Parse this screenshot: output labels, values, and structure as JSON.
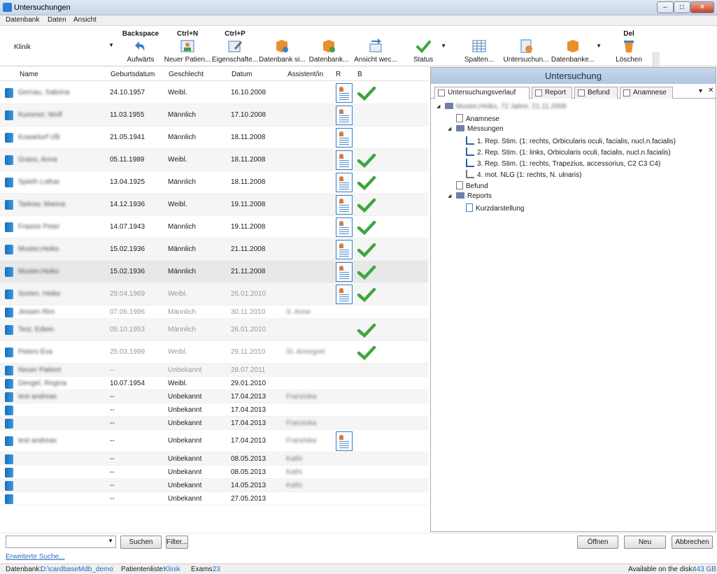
{
  "window": {
    "title": "Untersuchungen",
    "min": "‒",
    "max": "□",
    "close": "✕"
  },
  "menu": [
    "Datenbank",
    "Daten",
    "Ansicht"
  ],
  "toolbar": {
    "scope_value": "Klinik",
    "buttons": [
      {
        "shortcut": "Backspace",
        "label": "Aufwärts"
      },
      {
        "shortcut": "Ctrl+N",
        "label": "Neuer Patien..."
      },
      {
        "shortcut": "Ctrl+P",
        "label": "Eigenschafte..."
      },
      {
        "shortcut": "",
        "label": "Datenbank si..."
      },
      {
        "shortcut": "",
        "label": "Datenbank..."
      },
      {
        "shortcut": "",
        "label": "Ansicht wec..."
      },
      {
        "shortcut": "",
        "label": "Status"
      },
      {
        "shortcut": "",
        "label": "Spalten..."
      },
      {
        "shortcut": "",
        "label": "Untersuchun..."
      },
      {
        "shortcut": "",
        "label": "Datenbanke..."
      },
      {
        "shortcut": "Del",
        "label": "Löschen"
      }
    ]
  },
  "table": {
    "headers": [
      "Name",
      "Geburtsdatum",
      "Geschlecht",
      "Datum",
      "Assistent/in",
      "R",
      "B"
    ],
    "rows": [
      {
        "name": "Gernau, Sabrina",
        "birth": "24.10.1957",
        "sex": "Weibl.",
        "date": "16.10.2008",
        "asst": "",
        "r": true,
        "b": true
      },
      {
        "name": "Kummer, Wolf",
        "birth": "11.03.1955",
        "sex": "Männlich",
        "date": "17.10.2008",
        "asst": "",
        "r": true,
        "b": false
      },
      {
        "name": "Kowarturf Ulli",
        "birth": "21.05.1941",
        "sex": "Männlich",
        "date": "18.11.2008",
        "asst": "",
        "r": true,
        "b": false
      },
      {
        "name": "Graos, Anna",
        "birth": "05.11.1989",
        "sex": "Weibl.",
        "date": "18.11.2008",
        "asst": "",
        "r": true,
        "b": true
      },
      {
        "name": "Spieth Lothar",
        "birth": "13.04.1925",
        "sex": "Männlich",
        "date": "18.11.2008",
        "asst": "",
        "r": true,
        "b": true
      },
      {
        "name": "Tarkow, Marina",
        "birth": "14.12.1936",
        "sex": "Weibl.",
        "date": "19.11.2008",
        "asst": "",
        "r": true,
        "b": true
      },
      {
        "name": "Frasnix Peter",
        "birth": "14.07.1943",
        "sex": "Männlich",
        "date": "19.11.2008",
        "asst": "",
        "r": true,
        "b": true
      },
      {
        "name": "Muster,Heiko",
        "birth": "15.02.1936",
        "sex": "Männlich",
        "date": "21.11.2008",
        "asst": "",
        "r": true,
        "b": true
      },
      {
        "name": "Muster,Heiko",
        "birth": "15.02.1936",
        "sex": "Männlich",
        "date": "21.11.2008",
        "asst": "",
        "r": true,
        "b": true
      },
      {
        "name": "Sorten, Heike",
        "birth": "29.04.1969",
        "sex": "Weibl.",
        "date": "26.01.2010",
        "asst": "",
        "r": true,
        "b": true
      },
      {
        "name": "Jessen Rim",
        "birth": "07.06.1996",
        "sex": "Männlich",
        "date": "30.11.2010",
        "asst": "S. Anne",
        "r": false,
        "b": false
      },
      {
        "name": "Test, Edwin",
        "birth": "05.10.1953",
        "sex": "Männlich",
        "date": "26.01.2010",
        "asst": "",
        "r": false,
        "b": true
      },
      {
        "name": "Peters Eva",
        "birth": "25.03.1999",
        "sex": "Weibl.",
        "date": "29.11.2010",
        "asst": "St. Annegret",
        "r": false,
        "b": true
      },
      {
        "name": "Neuer Patient",
        "birth": "--",
        "sex": "Unbekannt",
        "date": "28.07.2011",
        "asst": "",
        "r": false,
        "b": false
      },
      {
        "name": "Dengel, Regina",
        "birth": "10.07.1954",
        "sex": "Weibl.",
        "date": "29.01.2010",
        "asst": "",
        "r": false,
        "b": false
      },
      {
        "name": "test andreas",
        "birth": "--",
        "sex": "Unbekannt",
        "date": "17.04.2013",
        "asst": "Franziska",
        "r": false,
        "b": false
      },
      {
        "name": "",
        "birth": "--",
        "sex": "Unbekannt",
        "date": "17.04.2013",
        "asst": "",
        "r": false,
        "b": false
      },
      {
        "name": "",
        "birth": "--",
        "sex": "Unbekannt",
        "date": "17.04.2013",
        "asst": "Franziska",
        "r": false,
        "b": false
      },
      {
        "name": "test andreas",
        "birth": "--",
        "sex": "Unbekannt",
        "date": "17.04.2013",
        "asst": "Franziska",
        "r": true,
        "b": false
      },
      {
        "name": "",
        "birth": "--",
        "sex": "Unbekannt",
        "date": "08.05.2013",
        "asst": "Kathi",
        "r": false,
        "b": false
      },
      {
        "name": "",
        "birth": "--",
        "sex": "Unbekannt",
        "date": "08.05.2013",
        "asst": "Kathi",
        "r": false,
        "b": false
      },
      {
        "name": "",
        "birth": "--",
        "sex": "Unbekannt",
        "date": "14.05.2013",
        "asst": "Kathi",
        "r": false,
        "b": false
      },
      {
        "name": "",
        "birth": "--",
        "sex": "Unbekannt",
        "date": "27.05.2013",
        "asst": "",
        "r": false,
        "b": false
      }
    ]
  },
  "search": {
    "button": "Suchen",
    "filter": "Filter...",
    "advanced": "Erweiterte Suche..."
  },
  "panel": {
    "title": "Untersuchung",
    "tabs": [
      "Untersuchungsverlauf",
      "Report",
      "Befund",
      "Anamnese"
    ],
    "pin": "▾",
    "close": "✕",
    "tree": {
      "root": "Muster,Heiko, 72 Jahre, 21.11.2008",
      "anamnese": "Anamnese",
      "messungen": "Messungen",
      "measurements": [
        "1. Rep. Stim. (1: rechts, Orbicularis oculi, facialis, nucl.n.facialis)",
        "2. Rep. Stim. (1: links, Orbicularis oculi, facialis, nucl.n.facialis)",
        "3. Rep. Stim. (1: rechts, Trapezius, accessorius, C2 C3 C4)",
        "4. mot. NLG (1: rechts, N. ulnaris)"
      ],
      "befund": "Befund",
      "reports": "Reports",
      "kurz": "Kurzdarstellung"
    }
  },
  "actions": {
    "open": "Öffnen",
    "new": "Neu",
    "cancel": "Abbrechen"
  },
  "status": {
    "db_label": "Datenbank:",
    "db_path": "D:\\cardbaseMdb_demo",
    "list_label": "Patientenliste:",
    "list_value": "Klinik",
    "exams_label": "Exams:",
    "exams_value": "23",
    "disk_label": "Available on the disk:",
    "disk_value": "443 GB"
  }
}
